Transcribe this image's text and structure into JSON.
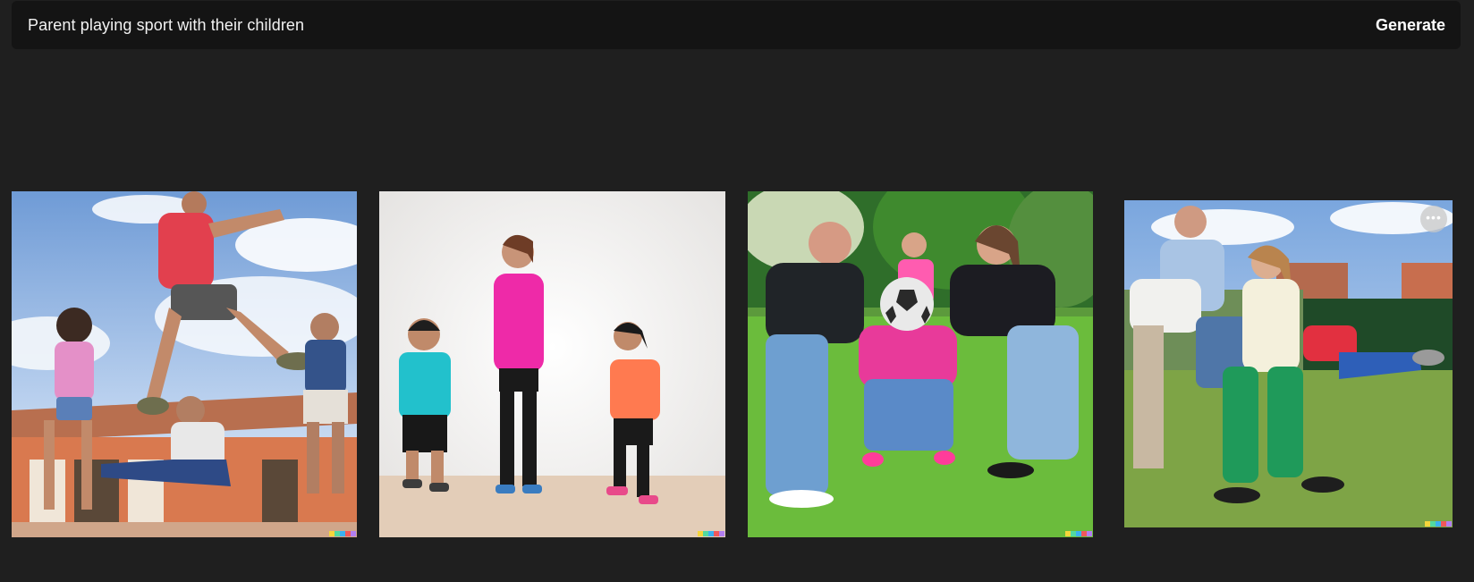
{
  "prompt": {
    "text": "Parent playing sport with their children",
    "generate_label": "Generate"
  },
  "results": [
    {
      "scene": "parent jumping with children outdoors",
      "has_menu": false
    },
    {
      "scene": "mother and two children in a bright studio",
      "has_menu": false
    },
    {
      "scene": "family holding a soccer ball on grass",
      "has_menu": false
    },
    {
      "scene": "family playing tug game in a garden",
      "has_menu": true
    }
  ],
  "more_button_label": "•••",
  "signature_colors": [
    "#f5d53b",
    "#52d9a0",
    "#3ab0f0",
    "#f0585a",
    "#b27ef0"
  ],
  "colors": {
    "background": "#1f1f1f",
    "prompt_bar": "#141414",
    "text": "#f2f2f2"
  }
}
